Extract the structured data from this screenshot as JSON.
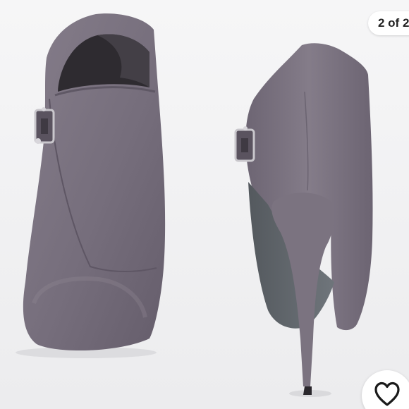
{
  "counter": {
    "text": "2 of 2"
  },
  "icons": {
    "like": "heart-icon"
  },
  "colors": {
    "suede": "#7a7280",
    "sole": "#5f6469",
    "background": "#f2f2f3"
  }
}
